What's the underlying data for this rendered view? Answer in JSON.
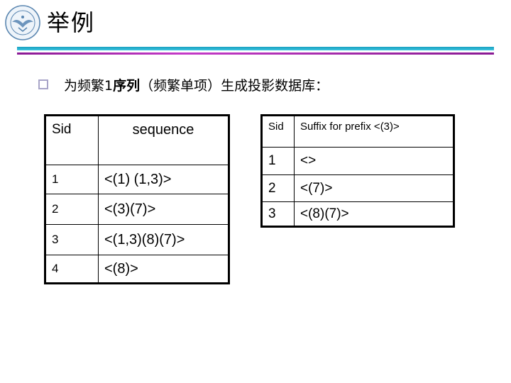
{
  "header": {
    "logo": "university-seal-logo",
    "title": "举例",
    "rule_colors": {
      "top": "#2ab4d4",
      "bottom": "#a82aae"
    }
  },
  "bullet": {
    "icon": "hollow-square-bullet",
    "text_part1": "为频繁1",
    "text_bold": "序列",
    "text_part2": "（频繁单项）生成投影数据库："
  },
  "sequence_table": {
    "headers": [
      "Sid",
      "sequence"
    ],
    "rows": [
      {
        "sid": "1",
        "sequence": "<(1) (1,3)>"
      },
      {
        "sid": "2",
        "sequence": "<(3)(7)>"
      },
      {
        "sid": "3",
        "sequence": "<(1,3)(8)(7)>"
      },
      {
        "sid": "4",
        "sequence": "<(8)>"
      }
    ]
  },
  "projection_table": {
    "headers": [
      "Sid",
      "Suffix for prefix <(3)>"
    ],
    "rows": [
      {
        "sid": "1",
        "suffix": "<>"
      },
      {
        "sid": "2",
        "suffix": "<(7)>"
      },
      {
        "sid": "3",
        "suffix": "<(8)(7)>"
      }
    ]
  }
}
